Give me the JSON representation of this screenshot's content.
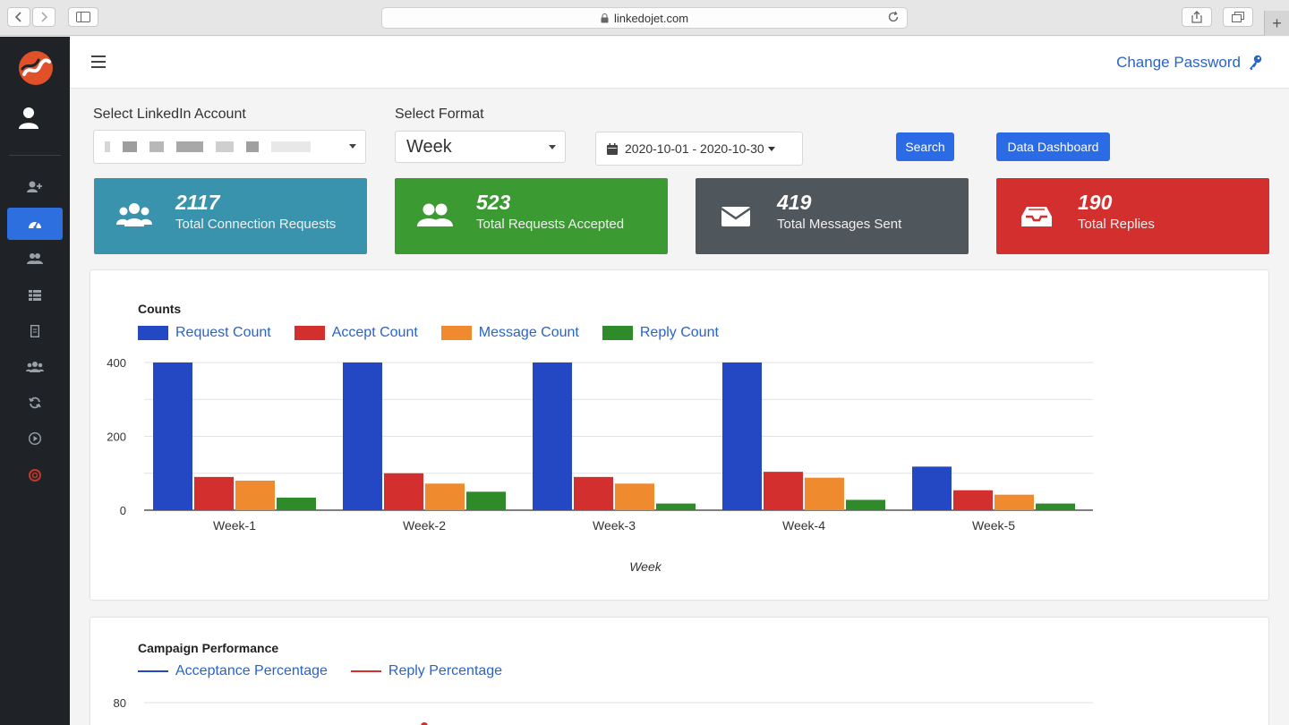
{
  "browser": {
    "url": "linkedojet.com"
  },
  "header": {
    "change_password": "Change Password"
  },
  "filters": {
    "account_label": "Select LinkedIn Account",
    "format_label": "Select Format",
    "format_value": "Week",
    "date_range": "2020-10-01 - 2020-10-30",
    "search_label": "Search",
    "dashboard_label": "Data Dashboard"
  },
  "cards": [
    {
      "value": "2117",
      "label": "Total Connection Requests",
      "color": "#3a93ad",
      "icon": "users-icon"
    },
    {
      "value": "523",
      "label": "Total Requests Accepted",
      "color": "#3c9a32",
      "icon": "user-group-icon"
    },
    {
      "value": "419",
      "label": "Total Messages Sent",
      "color": "#4f565c",
      "icon": "envelope-icon"
    },
    {
      "value": "190",
      "label": "Total Replies",
      "color": "#d42f2f",
      "icon": "inbox-icon"
    }
  ],
  "sidebar": {
    "items": [
      {
        "icon": "user-plus-icon",
        "active": false
      },
      {
        "icon": "dashboard-icon",
        "active": true
      },
      {
        "icon": "users-icon",
        "active": false
      },
      {
        "icon": "list-icon",
        "active": false
      },
      {
        "icon": "file-icon",
        "active": false
      },
      {
        "icon": "group-icon",
        "active": false
      },
      {
        "icon": "refresh-icon",
        "active": false
      },
      {
        "icon": "play-icon",
        "active": false
      },
      {
        "icon": "support-icon",
        "active": false
      }
    ]
  },
  "chart_data": [
    {
      "type": "bar",
      "title": "Counts",
      "xlabel": "Week",
      "ylabel": "",
      "ylim": [
        0,
        400
      ],
      "yticks": [
        0,
        200,
        400
      ],
      "legend": "top-left",
      "grid": true,
      "categories": [
        "Week-1",
        "Week-2",
        "Week-3",
        "Week-4",
        "Week-5"
      ],
      "series": [
        {
          "name": "Request Count",
          "color": "#2447c4",
          "values": [
            400,
            400,
            400,
            400,
            118
          ]
        },
        {
          "name": "Accept Count",
          "color": "#d42f2f",
          "values": [
            90,
            100,
            90,
            104,
            54
          ]
        },
        {
          "name": "Message Count",
          "color": "#ef8a2e",
          "values": [
            80,
            72,
            72,
            88,
            42
          ]
        },
        {
          "name": "Reply Count",
          "color": "#2f8a2a",
          "values": [
            34,
            50,
            18,
            28,
            18
          ]
        }
      ]
    },
    {
      "type": "line",
      "title": "Campaign Performance",
      "legend": "top-left",
      "grid": true,
      "yticks": [
        80
      ],
      "series": [
        {
          "name": "Acceptance Percentage",
          "color": "#2447c4"
        },
        {
          "name": "Reply Percentage",
          "color": "#d42f2f"
        }
      ]
    }
  ]
}
